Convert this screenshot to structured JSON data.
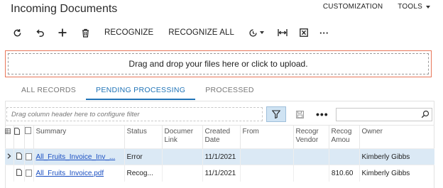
{
  "header": {
    "title": "Incoming Documents",
    "customization_label": "CUSTOMIZATION",
    "tools_label": "TOOLS"
  },
  "toolbar": {
    "refresh_icon": "refresh-icon",
    "undo_icon": "undo-icon",
    "add_icon": "plus-icon",
    "delete_icon": "trash-icon",
    "recognize_label": "RECOGNIZE",
    "recognize_all_label": "RECOGNIZE ALL",
    "actions_icon": "clock-icon",
    "fit_columns_icon": "fit-columns-icon",
    "excel_icon": "excel-export-icon",
    "more_label": "···"
  },
  "dropzone": {
    "text": "Drag and drop your files here or click to upload.",
    "accent_color": "#e8775a"
  },
  "tabs": [
    {
      "label": "ALL RECORDS",
      "active": false
    },
    {
      "label": "PENDING PROCESSING",
      "active": true
    },
    {
      "label": "PROCESSED",
      "active": false
    }
  ],
  "grid": {
    "group_placeholder": "Drag column header here to configure filter",
    "search_value": "",
    "more_label": "•••",
    "columns": {
      "summary": "Summary",
      "status": "Status",
      "document_link_1": "Documer",
      "document_link_2": "Link",
      "created_date_1": "Created",
      "created_date_2": "Date",
      "from": "From",
      "recognized_vendor_1": "Recogr",
      "recognized_vendor_2": "Vendor",
      "recognized_amount_1": "Recog",
      "recognized_amount_2": "Amou",
      "owner": "Owner"
    },
    "rows": [
      {
        "summary": "All_Fruits_Invoice_Inv_...",
        "status": "Error",
        "document_link": "",
        "created_date": "11/1/2021",
        "from": "",
        "recognized_vendor": "",
        "recognized_amount": "",
        "owner": "Kimberly Gibbs"
      },
      {
        "summary": "All_Fruits_Invoice.pdf",
        "status": "Recog...",
        "document_link": "",
        "created_date": "11/1/2021",
        "from": "",
        "recognized_vendor": "",
        "recognized_amount": "810.60",
        "owner": "Kimberly Gibbs"
      }
    ]
  },
  "colors": {
    "active_tab": "#1f73b7",
    "link": "#1a4fc2",
    "selected_row": "#dbe9f5"
  }
}
